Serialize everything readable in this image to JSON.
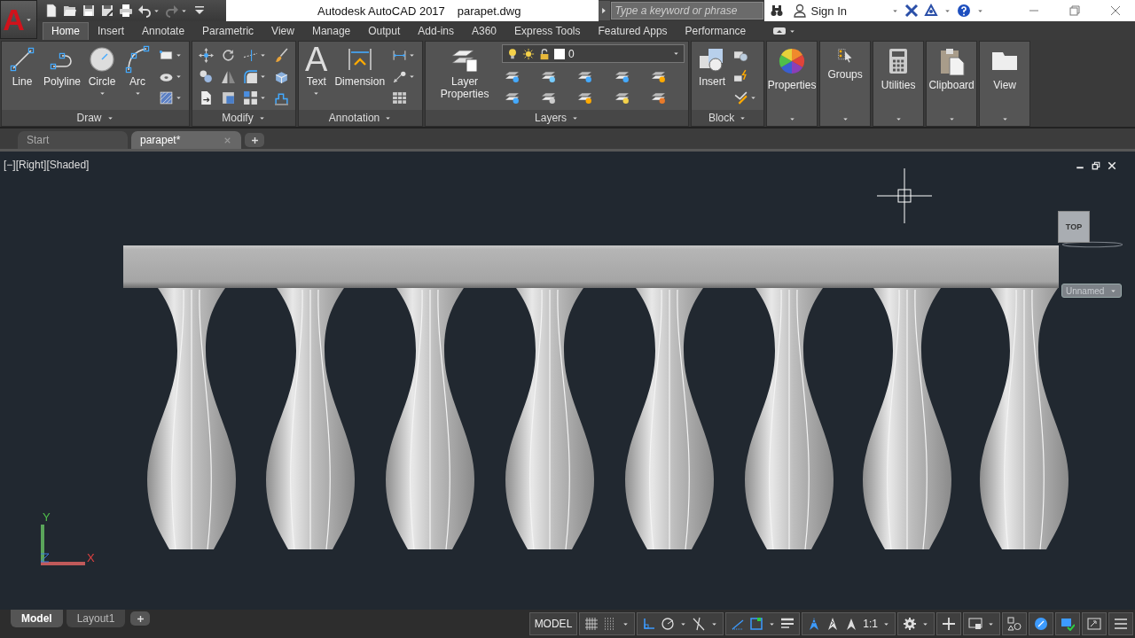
{
  "app_button": {
    "glyph": "A"
  },
  "quick_access": [
    {
      "kind": "new",
      "disabled": false,
      "dropdown": false
    },
    {
      "kind": "open",
      "disabled": false,
      "dropdown": false
    },
    {
      "kind": "save",
      "disabled": false,
      "dropdown": false
    },
    {
      "kind": "saveas",
      "disabled": false,
      "dropdown": false
    },
    {
      "kind": "print",
      "disabled": false,
      "dropdown": false
    },
    {
      "kind": "undo",
      "disabled": false,
      "dropdown": true
    },
    {
      "kind": "redo",
      "disabled": true,
      "dropdown": true
    },
    {
      "kind": "customize",
      "disabled": false,
      "dropdown": false
    }
  ],
  "title_bar": {
    "app_name": "Autodesk AutoCAD 2017",
    "file_name": "parapet.dwg",
    "search": {
      "placeholder": "Type a keyword or phrase"
    },
    "sign_in": "Sign In"
  },
  "ribbon_tabs": [
    {
      "label": "Home",
      "selected": true
    },
    {
      "label": "Insert",
      "selected": false
    },
    {
      "label": "Annotate",
      "selected": false
    },
    {
      "label": "Parametric",
      "selected": false
    },
    {
      "label": "View",
      "selected": false
    },
    {
      "label": "Manage",
      "selected": false
    },
    {
      "label": "Output",
      "selected": false
    },
    {
      "label": "Add-ins",
      "selected": false
    },
    {
      "label": "A360",
      "selected": false
    },
    {
      "label": "Express Tools",
      "selected": false
    },
    {
      "label": "Featured Apps",
      "selected": false
    },
    {
      "label": "Performance",
      "selected": false
    }
  ],
  "ribbon_panels": [
    {
      "kind": "tools",
      "title": "Draw",
      "large_tools": [
        {
          "label": "Line",
          "kind": "line",
          "dropdown": false
        },
        {
          "label": "Polyline",
          "kind": "polyline",
          "dropdown": false
        },
        {
          "label": "Circle",
          "kind": "circle",
          "dropdown": true
        },
        {
          "label": "Arc",
          "kind": "arc",
          "dropdown": true
        }
      ],
      "small_tools": [
        {
          "kind": "rectangle",
          "dropdown": true
        },
        {
          "kind": "ellipse",
          "dropdown": true
        },
        {
          "kind": "hatch",
          "dropdown": true
        }
      ]
    },
    {
      "kind": "tools",
      "title": "Modify",
      "small_tools": [
        {
          "kind": "move",
          "dropdown": false
        },
        {
          "kind": "copy",
          "dropdown": false
        },
        {
          "kind": "stretch",
          "dropdown": false
        },
        {
          "kind": "rotate",
          "dropdown": false
        },
        {
          "kind": "mirror",
          "dropdown": false
        },
        {
          "kind": "scale",
          "dropdown": false
        },
        {
          "kind": "trim",
          "dropdown": true
        },
        {
          "kind": "fillet",
          "dropdown": true
        },
        {
          "kind": "array",
          "dropdown": true
        },
        {
          "kind": "brush",
          "dropdown": false
        },
        {
          "kind": "cube",
          "dropdown": false
        },
        {
          "kind": "offset",
          "dropdown": false
        }
      ]
    },
    {
      "kind": "tools",
      "title": "Annotation",
      "large_tools": [
        {
          "label": "Text",
          "glyph": "A",
          "dropdown": true
        },
        {
          "label": "Dimension",
          "kind": "dimension",
          "dropdown": false
        }
      ],
      "small_tools": [
        {
          "kind": "lineardim",
          "dropdown": true
        },
        {
          "kind": "leader",
          "dropdown": true
        },
        {
          "kind": "table",
          "dropdown": false
        }
      ]
    },
    {
      "kind": "layers",
      "title": "Layers",
      "large_tools": [
        {
          "label": "Layer Properties",
          "kind": "layers",
          "dropdown": false
        }
      ],
      "layer_value": "0",
      "small_tools": [
        {
          "kind": "layer-a",
          "dropdown": false
        },
        {
          "kind": "layer-b",
          "dropdown": false
        },
        {
          "kind": "layer-c",
          "dropdown": false
        },
        {
          "kind": "layer-d",
          "dropdown": false
        },
        {
          "kind": "layer-e",
          "dropdown": false
        },
        {
          "kind": "layer-f",
          "dropdown": false
        },
        {
          "kind": "layer-g",
          "dropdown": false
        },
        {
          "kind": "layer-h",
          "dropdown": false
        },
        {
          "kind": "layer-i",
          "dropdown": false
        },
        {
          "kind": "layer-j",
          "dropdown": false
        }
      ]
    },
    {
      "kind": "tools",
      "title": "Block",
      "large_tools": [
        {
          "label": "Insert",
          "kind": "insert",
          "dropdown": false
        }
      ],
      "small_tools": [
        {
          "kind": "block",
          "dropdown": false
        },
        {
          "kind": "blockedit",
          "dropdown": false
        },
        {
          "kind": "attribute",
          "dropdown": true
        }
      ]
    },
    {
      "kind": "properties",
      "title": "Properties"
    },
    {
      "kind": "groups",
      "title": "Groups"
    },
    {
      "kind": "utilities",
      "title": "Utilities"
    },
    {
      "kind": "clipboard",
      "title": "Clipboard"
    },
    {
      "kind": "view",
      "title": "View"
    }
  ],
  "doc_tabs": [
    {
      "label": "Start",
      "selected": false,
      "closable": false
    },
    {
      "label": "parapet*",
      "selected": true,
      "closable": true
    }
  ],
  "viewport": {
    "controls": [
      "[−]",
      "[Right]",
      "[Shaded]"
    ],
    "viewcube": "TOP",
    "view_name": "Unnamed",
    "ucs": {
      "x": "X",
      "y": "Y"
    }
  },
  "layout_tabs": [
    {
      "label": "Model",
      "selected": true
    },
    {
      "label": "Layout1",
      "selected": false
    }
  ],
  "status_bar": {
    "groups": [
      {
        "items": [
          {
            "kind": "space",
            "label": "MODEL",
            "on": false,
            "dropdown": false
          }
        ]
      },
      {
        "items": [
          {
            "kind": "grid",
            "on": false,
            "dropdown": false
          },
          {
            "kind": "snap",
            "on": false,
            "dropdown": true
          }
        ]
      },
      {
        "items": [
          {
            "kind": "ortho",
            "on": true,
            "dropdown": false
          },
          {
            "kind": "polar",
            "on": false,
            "dropdown": true
          },
          {
            "kind": "iso",
            "on": false,
            "dropdown": true
          }
        ]
      },
      {
        "items": [
          {
            "kind": "track",
            "on": true,
            "dropdown": false
          },
          {
            "kind": "osnap",
            "on": true,
            "dropdown": true
          },
          {
            "kind": "lineweight",
            "on": false,
            "dropdown": false
          }
        ]
      },
      {
        "items": [
          {
            "kind": "annovis",
            "on": true,
            "dropdown": false
          },
          {
            "kind": "autoscale",
            "on": false,
            "dropdown": false
          },
          {
            "kind": "annomon",
            "on": false,
            "dropdown": false
          },
          {
            "kind": "scale",
            "label": "1:1",
            "on": false,
            "dropdown": true
          }
        ]
      },
      {
        "items": [
          {
            "kind": "gear",
            "on": false,
            "dropdown": true
          }
        ]
      },
      {
        "items": [
          {
            "kind": "plus",
            "on": false,
            "dropdown": false
          }
        ]
      },
      {
        "items": [
          {
            "kind": "isolate",
            "on": false,
            "dropdown": true
          }
        ]
      },
      {
        "items": [
          {
            "kind": "shapes",
            "on": false,
            "dropdown": false
          }
        ]
      },
      {
        "items": [
          {
            "kind": "gauge",
            "on": true,
            "dropdown": false
          }
        ]
      },
      {
        "items": [
          {
            "kind": "workspace",
            "on": true,
            "dropdown": false
          }
        ]
      },
      {
        "items": [
          {
            "kind": "fullscreen",
            "on": false,
            "dropdown": false
          }
        ]
      },
      {
        "items": [
          {
            "kind": "menu",
            "on": false,
            "dropdown": false
          }
        ]
      }
    ]
  }
}
